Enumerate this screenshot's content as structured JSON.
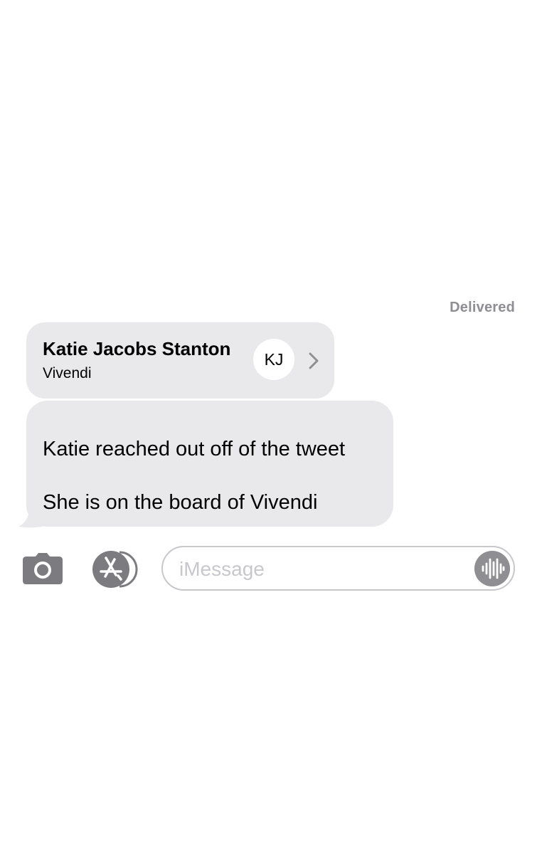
{
  "status": {
    "delivered": "Delivered"
  },
  "contact_card": {
    "name": "Katie Jacobs Stanton",
    "subtitle": "Vivendi",
    "initials": "KJ",
    "chevron_icon": "chevron-right-icon"
  },
  "message": {
    "lines": [
      "Katie reached out off of the tweet",
      "She is on the board of Vivendi"
    ]
  },
  "composer": {
    "camera_icon": "camera-icon",
    "apps_icon": "app-store-icon",
    "placeholder": "iMessage",
    "audio_icon": "audio-waveform-icon"
  },
  "colors": {
    "bubble_gray": "#e9e9eb",
    "secondary_text": "#8e8e93",
    "border": "#c7c7cc"
  }
}
